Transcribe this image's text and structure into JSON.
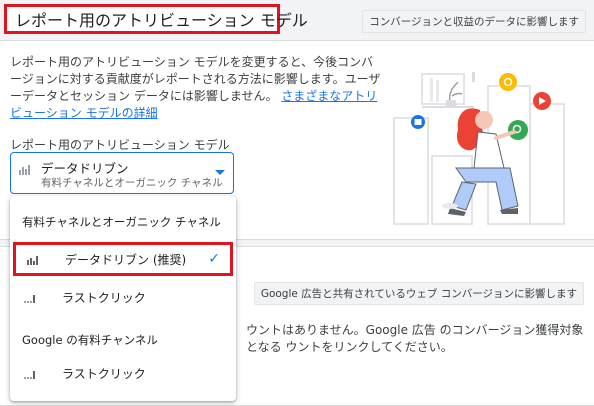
{
  "header": {
    "title": "レポート用のアトリビューション モデル",
    "badge": "コンバージョンと収益のデータに影響します"
  },
  "description": {
    "text": "レポート用のアトリビューション モデルを変更すると、今後コンバージョンに対する貢献度がレポートされる方法に影響します。ユーザーデータとセッション データには影響しません。",
    "link": "さまざまなアトリビューション モデルの詳細"
  },
  "select": {
    "label": "レポート用のアトリビューション モデル",
    "value": "データドリブン",
    "subvalue": "有料チャネルとオーガニック チャネル"
  },
  "dropdown": {
    "group1_header": "有料チャネルとオーガニック チャネル",
    "item_datadriven": "データドリブン (推奨)",
    "item_lastclick1": "ラストクリック",
    "group2_header": "Google の有料チャンネル",
    "item_lastclick2": "ラストクリック"
  },
  "bottom": {
    "badge": "Google 広告と共有されているウェブ コンバージョンに影響します",
    "text": "ウントはありません。Google 広告 のコンバージョン獲得対象となる ウントをリンクしてください。"
  },
  "colors": {
    "accent": "#1a73e8",
    "highlight": "#e0141e"
  }
}
